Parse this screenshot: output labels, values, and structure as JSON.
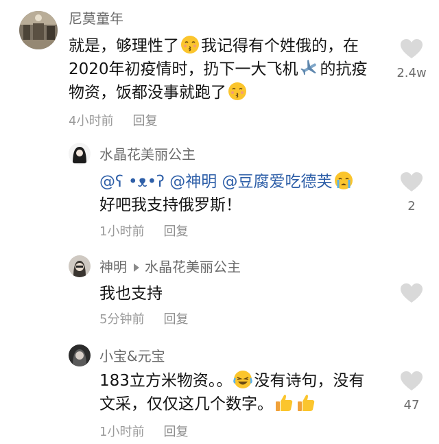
{
  "comments": [
    {
      "username": "尼莫童年",
      "text_lines": [
        "就是，够理性了",
        "我记得有个姓俄的，在",
        "2020年初疫情时，扔下一大飞机",
        "的抗疫",
        "物资，饭都没事就跑了"
      ],
      "time": "4小时前",
      "reply_label": "回复",
      "likes": "2.4w",
      "emojis": [
        "kissing-face-icon",
        "airplane-icon",
        "kissing-face-icon"
      ]
    },
    {
      "username": "水晶花美丽公主",
      "mention_prefix": "@ʕ •ᴥ•ʔ",
      "mention_1": "@神明",
      "mention_2": "@豆腐爱吃德芙",
      "text_line2": "好吧我支持俄罗斯！",
      "time": "1小时前",
      "reply_label": "回复",
      "likes": "2",
      "emojis": [
        "crying-face-icon"
      ]
    },
    {
      "username": "神明",
      "reply_to": "水晶花美丽公主",
      "text": "我也支持",
      "time": "5分钟前",
      "reply_label": "回复",
      "likes": ""
    },
    {
      "username": "小宝&元宝",
      "text_part1": "183立方米物资。。",
      "text_part2": "没有诗句，没有",
      "text_line2": "文采，仅仅这几个数字。",
      "time": "1小时前",
      "reply_label": "回复",
      "likes": "47",
      "emojis": [
        "crying-laughing-face-icon",
        "thumbs-up-icon",
        "thumbs-up-icon"
      ]
    }
  ],
  "colors": {
    "username": "#6b6b6b",
    "mention": "#2e5fa8",
    "meta": "#9a9a9a",
    "heart": "#d9d9d9"
  }
}
